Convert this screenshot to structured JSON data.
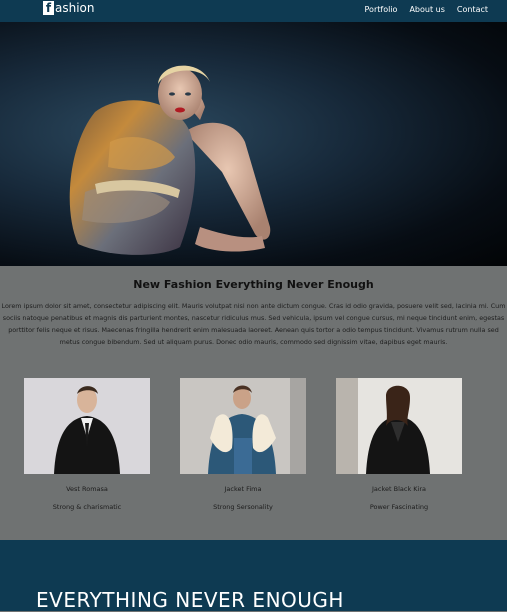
{
  "nav": {
    "logo_mark": "f",
    "logo_text": "ashion",
    "links": [
      "Portfolio",
      "About us",
      "Contact"
    ]
  },
  "intro": {
    "title": "New Fashion Everything Never Enough",
    "text": "Lorem ipsum dolor sit amet, consectetur adipiscing elit. Mauris volutpat nisi non ante dictum congue. Cras id odio gravida, posuere velit sed, lacinia mi. Cum sociis natoque penatibus et magnis dis parturient montes, nascetur ridiculus mus. Sed vehicula, ipsum vel congue cursus, mi neque tincidunt enim, egestas porttitor felis neque et risus. Maecenas fringilla hendrerit enim malesuada laoreet. Aenean quis tortor a odio tempus tincidunt. Vivamus rutrum nulla sed metus congue bibendum. Sed ut aliquam purus. Donec odio mauris, commodo sed dignissim vitae, dapibus eget mauris."
  },
  "cards": [
    {
      "name": "Vest Romasa",
      "desc": "Strong & charismatic"
    },
    {
      "name": "Jacket Fima",
      "desc": "Strong Sersonality"
    },
    {
      "name": "Jacket Black Kira",
      "desc": "Power Fascinating"
    }
  ],
  "bottom": {
    "title": "EVERYTHING NEVER ENOUGH"
  },
  "colors": {
    "nav_bg": "#0e3a52",
    "section_bg": "#6f7272",
    "bottom_bg": "#0e3a52"
  }
}
